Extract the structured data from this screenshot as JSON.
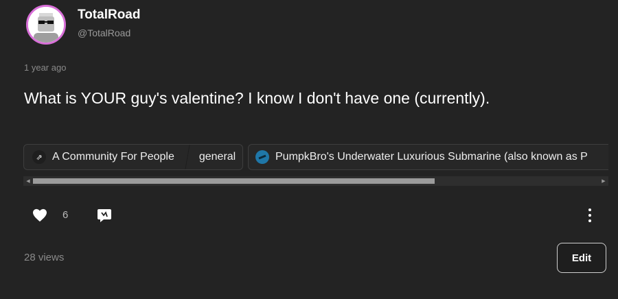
{
  "author": {
    "display_name": "TotalRoad",
    "handle": "@TotalRoad",
    "avatar_icon": "sunglasses-avatar-icon"
  },
  "post": {
    "timestamp": "1 year ago",
    "body": "What is YOUR guy's valentine? I know I don't have one (currently).",
    "communities": [
      {
        "name": "A Community For People",
        "channel": "general",
        "icon": "community-icon"
      },
      {
        "name": "PumpkBro's Underwater Luxurious Submarine (also known as P",
        "icon": "submarine-icon"
      }
    ]
  },
  "actions": {
    "like_count": "6",
    "views_text": "28 views",
    "edit_label": "Edit"
  },
  "colors": {
    "background": "#232323",
    "avatar_ring": "#d86fd8",
    "text_muted": "#8a8a8a"
  }
}
